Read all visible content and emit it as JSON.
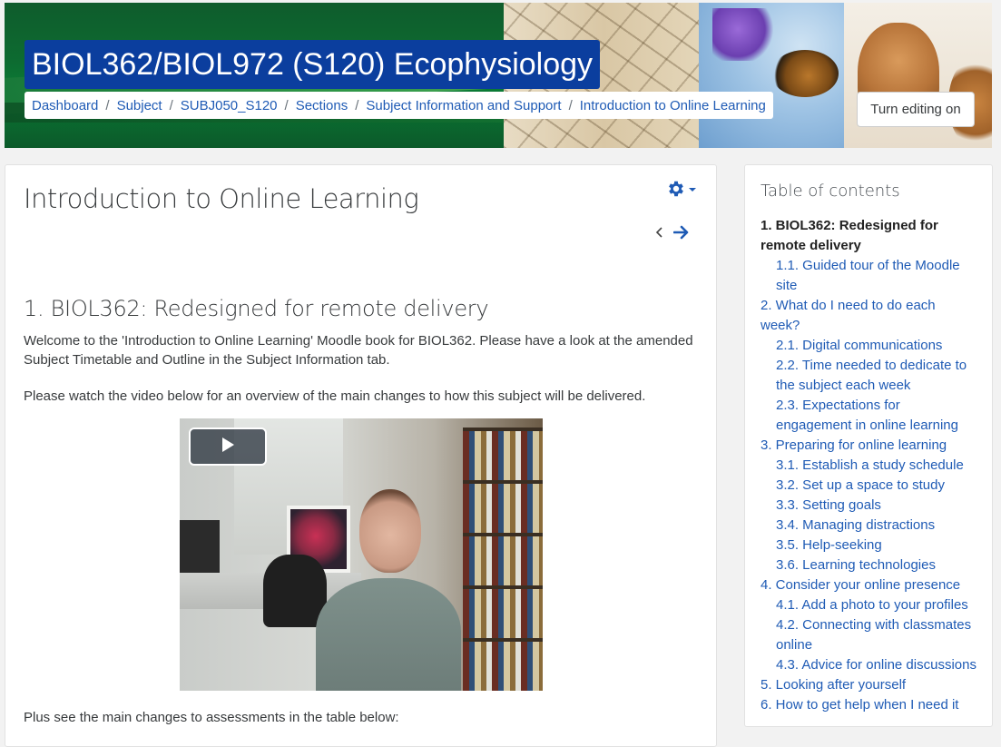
{
  "header": {
    "course_title": "BIOL362/BIOL972 (S120) Ecophysiology",
    "breadcrumb": [
      "Dashboard",
      "Subject",
      "SUBJ050_S120",
      "Sections",
      "Subject Information and Support",
      "Introduction to Online Learning"
    ],
    "edit_button": "Turn editing on"
  },
  "main": {
    "page_title": "Introduction to Online Learning",
    "section_heading": "1. BIOL362: Redesigned for remote delivery",
    "paragraph1": "Welcome to the 'Introduction to Online Learning' Moodle book for BIOL362. Please have a look at the amended Subject Timetable and Outline in the Subject Information tab.",
    "paragraph2": "Please watch the video below for an overview of the main changes to how this subject will be delivered.",
    "paragraph3": "Plus see the main changes to assessments in the table below:",
    "icons": {
      "settings": "gear-icon",
      "prev": "chevron-left-icon",
      "next": "arrow-right-icon",
      "play": "play-icon"
    }
  },
  "toc": {
    "title": "Table of contents",
    "items": [
      {
        "label": "1. BIOL362: Redesigned for remote delivery",
        "level": 1,
        "active": true
      },
      {
        "label": "1.1. Guided tour of the Moodle site",
        "level": 2
      },
      {
        "label": "2. What do I need to do each week?",
        "level": 1
      },
      {
        "label": "2.1. Digital communications",
        "level": 2
      },
      {
        "label": "2.2. Time needed to dedicate to the subject each week",
        "level": 2
      },
      {
        "label": "2.3. Expectations for engagement in online learning",
        "level": 2
      },
      {
        "label": "3. Preparing for online learning",
        "level": 1
      },
      {
        "label": "3.1. Establish a study schedule",
        "level": 2
      },
      {
        "label": "3.2. Set up a space to study",
        "level": 2
      },
      {
        "label": "3.3. Setting goals",
        "level": 2
      },
      {
        "label": "3.4. Managing distractions",
        "level": 2
      },
      {
        "label": "3.5. Help-seeking",
        "level": 2
      },
      {
        "label": "3.6. Learning technologies",
        "level": 2
      },
      {
        "label": "4. Consider your online presence",
        "level": 1
      },
      {
        "label": "4.1. Add a photo to your profiles",
        "level": 2
      },
      {
        "label": "4.2. Connecting with classmates online",
        "level": 2
      },
      {
        "label": "4.3. Advice for online discussions",
        "level": 2
      },
      {
        "label": "5. Looking after yourself",
        "level": 1
      },
      {
        "label": "6. How to get help when I need it",
        "level": 1
      }
    ]
  },
  "colors": {
    "link": "#1f5bb5",
    "title_bg": "#0b3e9e",
    "accent": "#0f6cbf"
  }
}
